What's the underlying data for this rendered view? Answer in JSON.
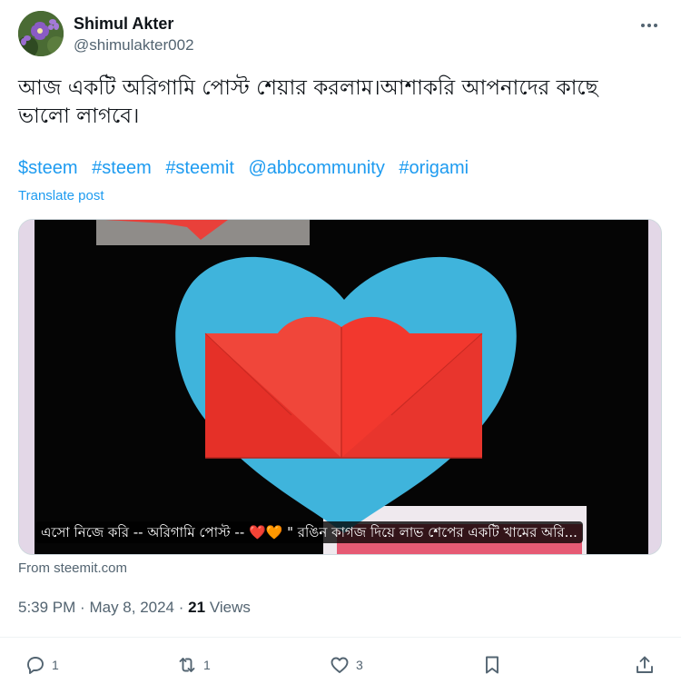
{
  "author": {
    "name": "Shimul Akter",
    "handle": "@shimulakter002",
    "avatar_icon": "flower-avatar"
  },
  "post": {
    "text": "আজ একটি অরিগামি পোস্ট শেয়ার করলাম।আশাকরি আপনাদের কাছে ভালো লাগবে।",
    "tags": [
      "$steem",
      "#steem",
      "#steemit",
      "@abbcommunity",
      "#origami"
    ],
    "translate_label": "Translate post"
  },
  "media": {
    "caption": "এসো নিজে করি -- অরিগামি পোস্ট -- ❤️🧡 \" রঙিন কাগজ দিয়ে লাভ শেপের একটি খামের অরি...",
    "source": "From steemit.com"
  },
  "meta": {
    "time": "5:39 PM",
    "separator": "·",
    "date": "May 8, 2024",
    "views_count": "21",
    "views_label": "Views"
  },
  "actions": {
    "reply_count": "1",
    "repost_count": "1",
    "like_count": "3"
  },
  "colors": {
    "accent": "#1d9bf0",
    "secondary_text": "#536471",
    "heart_blue": "#3fb4dc",
    "envelope_red": "#f2382e"
  }
}
